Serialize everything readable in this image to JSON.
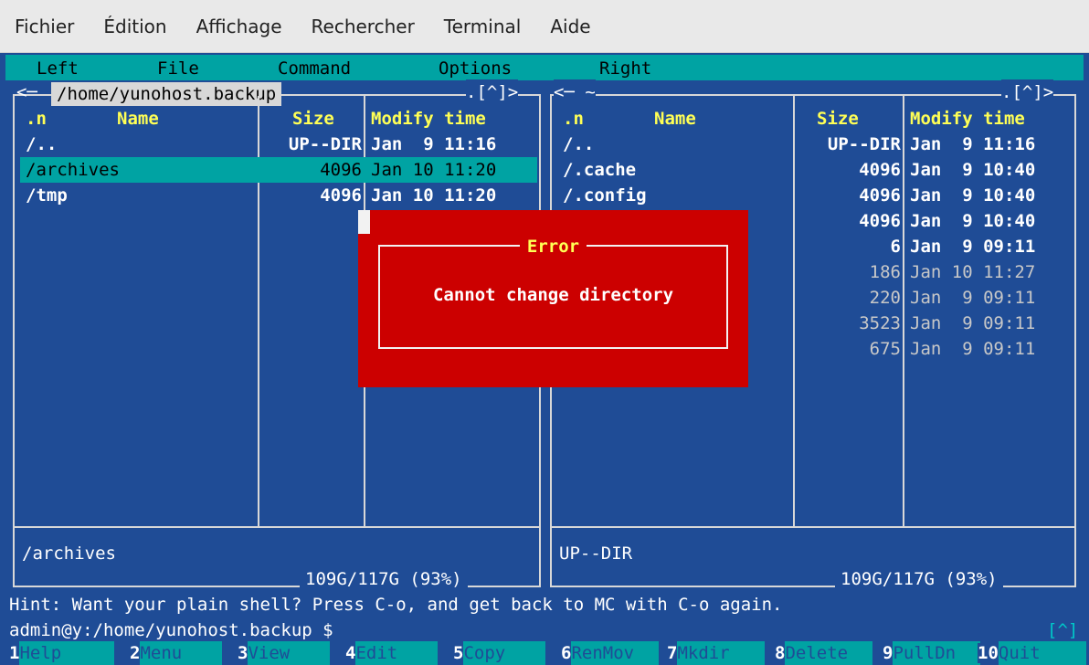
{
  "app_menu": [
    "Fichier",
    "Édition",
    "Affichage",
    "Rechercher",
    "Terminal",
    "Aide"
  ],
  "mc_menu": [
    "Left",
    "File",
    "Command",
    "Options",
    "Right"
  ],
  "left_panel": {
    "path": "/home/yunohost.backup",
    "corner": ".[^]>",
    "columns": {
      "n": ".n",
      "name": "Name",
      "size": "Size",
      "mtime": "Modify time"
    },
    "rows": [
      {
        "name": "/..",
        "size": "UP--DIR",
        "time": "Jan  9 11:16"
      },
      {
        "name": "/archives",
        "size": "4096",
        "time": "Jan 10 11:20"
      },
      {
        "name": "/tmp",
        "size": "4096",
        "time": "Jan 10 11:20"
      }
    ],
    "mini_status": "/archives",
    "free_space": "109G/117G (93%)"
  },
  "right_panel": {
    "path": "~",
    "corner": ".[^]>",
    "columns": {
      "n": ".n",
      "name": "Name",
      "size": "Size",
      "mtime": "Modify time"
    },
    "rows": [
      {
        "name": "/..",
        "size": "UP--DIR",
        "time": "Jan  9 11:16"
      },
      {
        "name": "/.cache",
        "size": "4096",
        "time": "Jan  9 10:40"
      },
      {
        "name": "/.config",
        "size": "4096",
        "time": "Jan  9 10:40"
      },
      {
        "name": "",
        "size": "4096",
        "time": "Jan  9 10:40"
      },
      {
        "name": "",
        "size": "6",
        "time": "Jan  9 09:11"
      },
      {
        "name": "",
        "size": "186",
        "time": "Jan 10 11:27"
      },
      {
        "name": "",
        "size": "220",
        "time": "Jan  9 09:11"
      },
      {
        "name": "",
        "size": "3523",
        "time": "Jan  9 09:11"
      },
      {
        "name": "",
        "size": "675",
        "time": "Jan  9 09:11"
      }
    ],
    "mini_status": "UP--DIR",
    "free_space": "109G/117G (93%)"
  },
  "dialog": {
    "title": "Error",
    "message": "Cannot change directory"
  },
  "hint": "Hint: Want your plain shell? Press C-o, and get back to MC with C-o again.",
  "prompt": "admin@y:/home/yunohost.backup $",
  "prompt_corner": "[^]",
  "fkeys": [
    {
      "num": "1",
      "label": "Help"
    },
    {
      "num": "2",
      "label": "Menu"
    },
    {
      "num": "3",
      "label": "View"
    },
    {
      "num": "4",
      "label": "Edit"
    },
    {
      "num": "5",
      "label": "Copy"
    },
    {
      "num": "6",
      "label": "RenMov"
    },
    {
      "num": "7",
      "label": "Mkdir"
    },
    {
      "num": "8",
      "label": "Delete"
    },
    {
      "num": "9",
      "label": "PullDn"
    },
    {
      "num": "10",
      "label": "Quit"
    }
  ]
}
